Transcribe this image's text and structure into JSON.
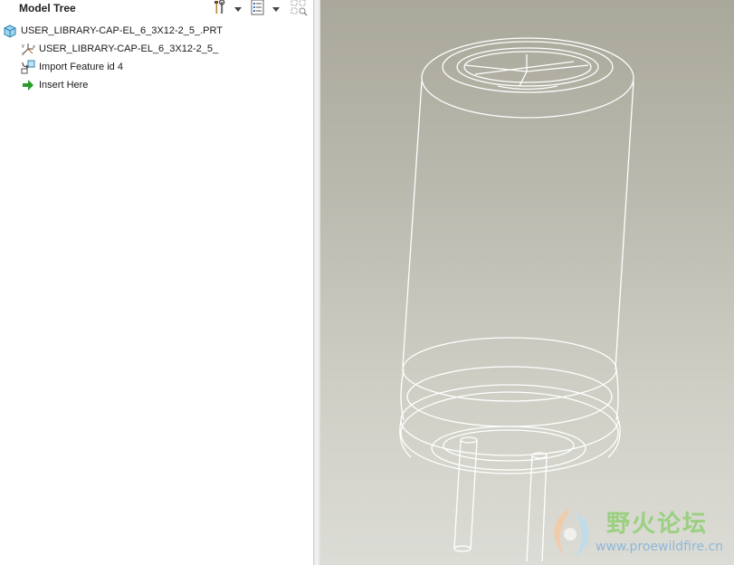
{
  "model_tree": {
    "title": "Model Tree",
    "toolbar": {
      "settings_icon": "hammer-wrench-icon",
      "tree_filters_icon": "list-icon",
      "show_icon": "show-select-icon"
    },
    "items": [
      {
        "label": "USER_LIBRARY-CAP-EL_6_3X12-2_5_.PRT",
        "icon": "part-icon"
      },
      {
        "label": "USER_LIBRARY-CAP-EL_6_3X12-2_5_",
        "icon": "coordinate-system-icon"
      },
      {
        "label": "Import Feature id 4",
        "icon": "import-feature-icon"
      },
      {
        "label": "Insert Here",
        "icon": "insert-arrow-icon"
      }
    ]
  },
  "watermark": {
    "text_cn": "野火论坛",
    "url": "www.proewildfire.cn"
  },
  "colors": {
    "viewport_bg_top": "#a9a89a",
    "viewport_bg_bottom": "#dcdcd6",
    "wireframe": "#ffffff",
    "insert_arrow": "#2a9a2a"
  }
}
